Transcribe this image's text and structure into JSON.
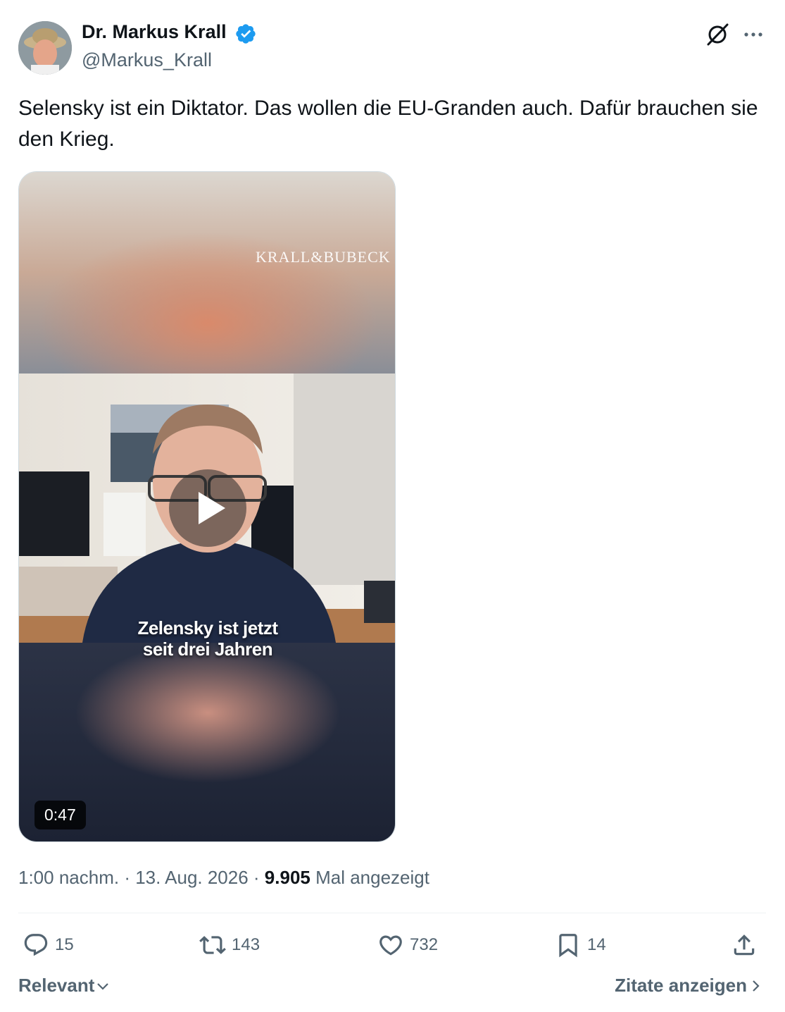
{
  "author": {
    "display_name": "Dr. Markus Krall",
    "handle": "@Markus_Krall",
    "verified": true,
    "verified_color": "#1d9bf0"
  },
  "header_icons": [
    "grok-icon",
    "more-icon"
  ],
  "tweet": {
    "text": "Selensky ist ein Diktator. Das wollen die EU-Granden auch. Dafür brauchen sie den Krieg."
  },
  "media": {
    "watermark": "KRALL&BUBECK",
    "caption_line1": "Zelensky ist jetzt",
    "caption_line2": "seit drei Jahren",
    "duration": "0:47"
  },
  "meta": {
    "time": "1:00 nachm.",
    "separator1": " · ",
    "date": "13. Aug. 2026",
    "separator2": " · ",
    "views_count": "9.905",
    "views_label": " Mal angezeigt"
  },
  "actions": {
    "replies": "15",
    "reposts": "143",
    "likes": "732",
    "bookmarks": "14"
  },
  "footer": {
    "sort_label": "Relevant",
    "quotes_label": "Zitate anzeigen"
  },
  "colors": {
    "text": "#0f1419",
    "secondary": "#536471",
    "accent": "#1d9bf0"
  }
}
